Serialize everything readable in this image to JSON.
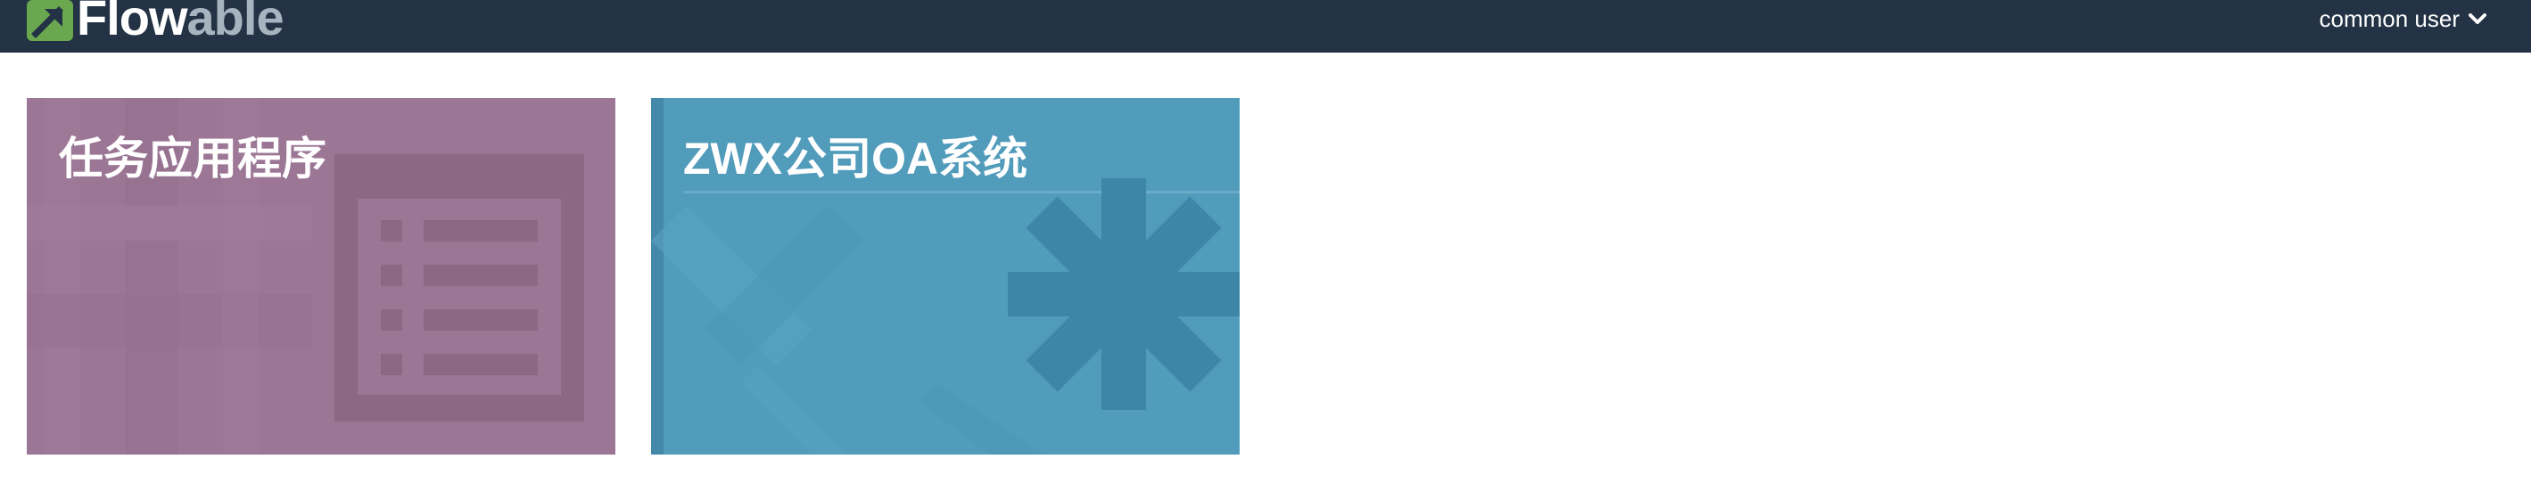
{
  "header": {
    "logo": {
      "name": "Flowable",
      "part1": "Flow",
      "part2": "able",
      "mark_color": "#6aa84f"
    },
    "user_menu": {
      "label": "common user",
      "icon": "chevron-down-icon"
    },
    "background_color": "#233244"
  },
  "apps": [
    {
      "title": "任务应用程序",
      "icon": "list-icon",
      "color": "#9c7695"
    },
    {
      "title": "ZWX公司OA系统",
      "icon": "asterisk-icon",
      "color": "#519bbb"
    }
  ]
}
